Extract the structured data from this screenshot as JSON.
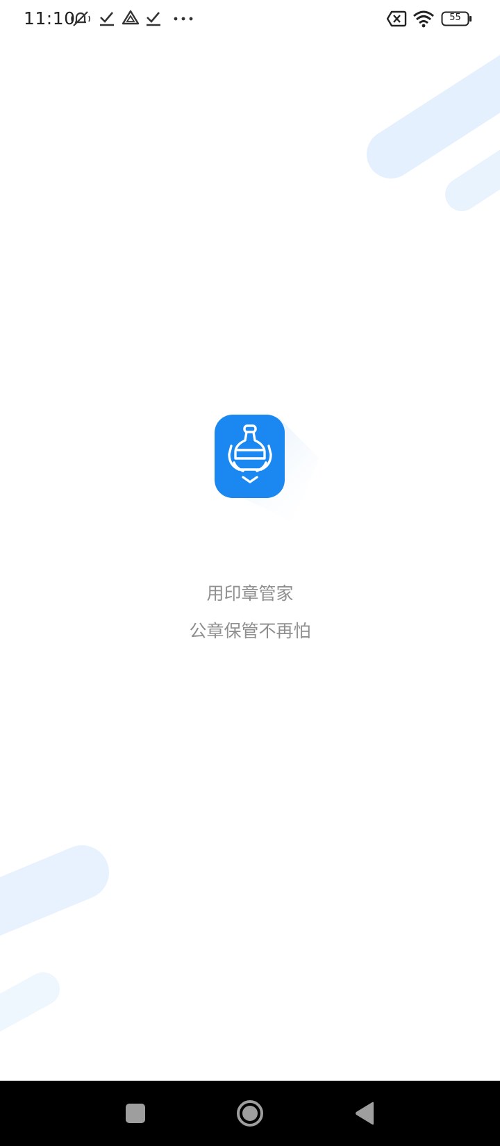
{
  "status_bar": {
    "time": "11:10",
    "battery_level": "55",
    "icons": [
      "mute-icon",
      "check-icon",
      "drive-icon",
      "check-icon",
      "more-icon",
      "sim-off-icon",
      "wifi-icon",
      "battery-icon"
    ]
  },
  "splash": {
    "app_name": "用印章管家",
    "tagline": "公章保管不再怕"
  },
  "colors": {
    "accent": "#1a88f0",
    "decoration": "#e4f0fd",
    "text_gray": "#8f8f8f"
  },
  "nav_bar": {
    "buttons": [
      "recents-button",
      "home-button",
      "back-button"
    ]
  }
}
